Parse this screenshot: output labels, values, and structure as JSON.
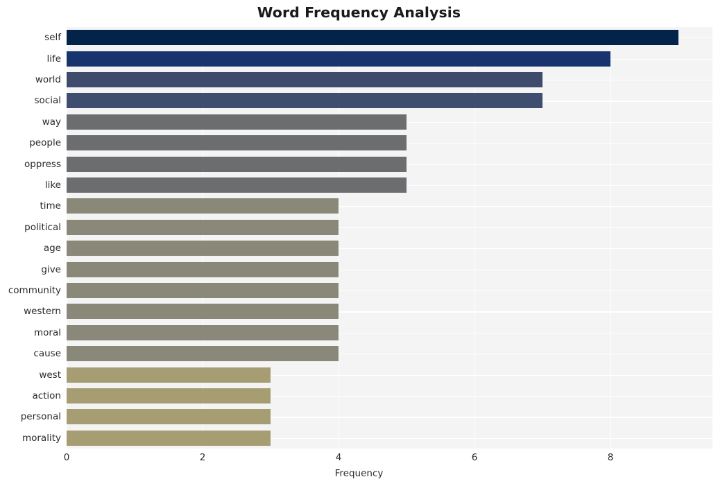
{
  "chart_data": {
    "type": "bar",
    "orientation": "horizontal",
    "title": "Word Frequency Analysis",
    "xlabel": "Frequency",
    "ylabel": "",
    "categories": [
      "self",
      "life",
      "world",
      "social",
      "way",
      "people",
      "oppress",
      "like",
      "time",
      "political",
      "age",
      "give",
      "community",
      "western",
      "moral",
      "cause",
      "west",
      "action",
      "personal",
      "morality"
    ],
    "values": [
      9,
      8,
      7,
      7,
      5,
      5,
      5,
      5,
      4,
      4,
      4,
      4,
      4,
      4,
      4,
      4,
      3,
      3,
      3,
      3
    ],
    "bar_colors": [
      "#04234b",
      "#17346e",
      "#3e4b6d",
      "#3f4d6e",
      "#6c6d6f",
      "#6c6d6f",
      "#6c6d6f",
      "#6c6d6f",
      "#8a8878",
      "#8a8878",
      "#8a8878",
      "#8a8878",
      "#8a8878",
      "#8a8878",
      "#8a8878",
      "#8a8878",
      "#a69d72",
      "#a69d72",
      "#a69d72",
      "#a69d72"
    ],
    "xticks": [
      0,
      2,
      4,
      6,
      8
    ],
    "xtick_labels": [
      "0",
      "2",
      "4",
      "6",
      "8"
    ],
    "xlim": [
      0,
      9.5
    ],
    "grid": true,
    "grid_color": "#ffffff",
    "plot_background": "#f4f4f5",
    "figure_background": "#ffffff",
    "legend": null
  }
}
